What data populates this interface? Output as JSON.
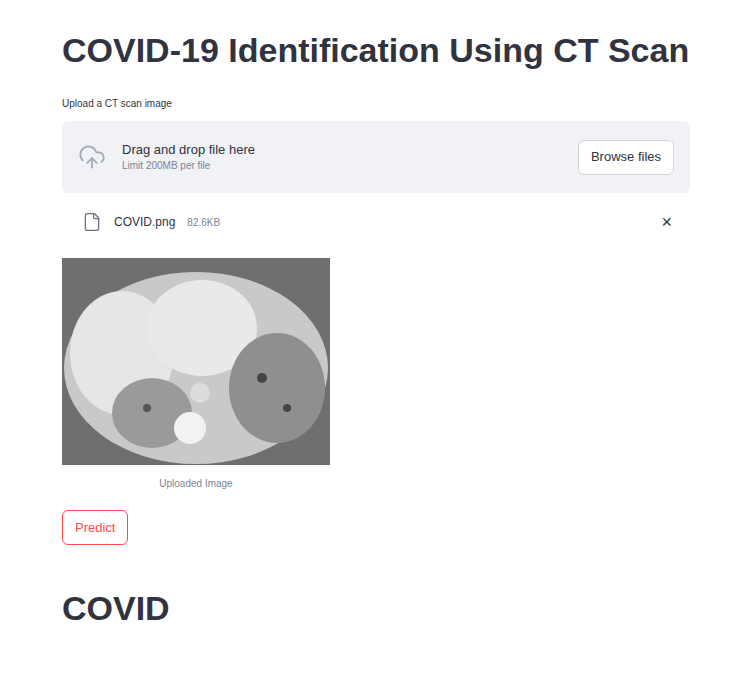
{
  "title": "COVID-19 Identification Using CT Scan",
  "uploader": {
    "label": "Upload a CT scan image",
    "drop_text": "Drag and drop file here",
    "limit": "Limit 200MB per file",
    "button": "Browse files"
  },
  "file": {
    "name": "COVID.png",
    "size": "82.6KB",
    "remove": "×"
  },
  "image": {
    "caption": "Uploaded Image"
  },
  "predict_button": {
    "label": "Predict",
    "focused": true
  },
  "result": "COVID"
}
